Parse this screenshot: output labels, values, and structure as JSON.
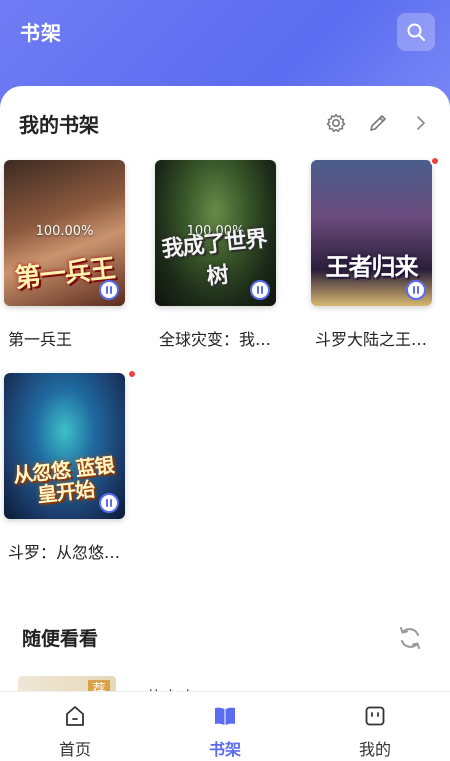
{
  "header": {
    "title": "书架",
    "search_icon": "search-icon"
  },
  "shelf": {
    "title": "我的书架",
    "icons": [
      "gear-icon",
      "pencil-icon",
      "chevron-right-icon"
    ],
    "books": [
      {
        "title": "第一兵王",
        "progress": "100.00%",
        "cover_text": "第一兵王",
        "has_dot": false
      },
      {
        "title": "全球灾变：我成了世界树",
        "progress": "100.00%",
        "cover_text": "我成了世界树",
        "has_dot": false
      },
      {
        "title": "斗罗大陆之王者归来",
        "progress": "",
        "cover_text": "王者归来",
        "has_dot": true
      },
      {
        "title": "斗罗：从忽悠蓝银皇开始",
        "progress": "",
        "cover_text": "从忽悠 蓝银皇开始",
        "has_dot": true
      }
    ]
  },
  "random": {
    "title": "随便看看",
    "peek_tag": "荐",
    "peek_title": "五花大肉"
  },
  "tabs": [
    {
      "label": "首页",
      "icon": "home-icon",
      "active": false
    },
    {
      "label": "书架",
      "icon": "book-icon",
      "active": true
    },
    {
      "label": "我的",
      "icon": "user-icon",
      "active": false
    }
  ],
  "colors": {
    "accent": "#5b6cf0",
    "dot": "#f0403c"
  }
}
